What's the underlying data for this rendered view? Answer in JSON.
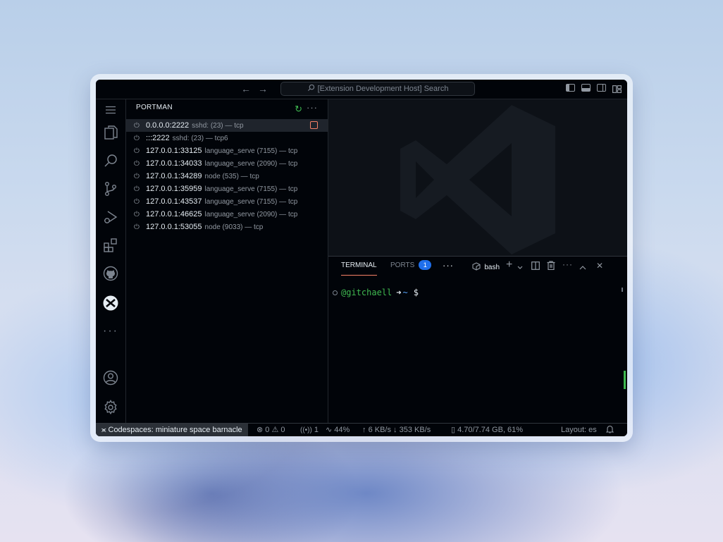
{
  "titlebar": {
    "back_icon": "←",
    "forward_icon": "→",
    "search_label": "[Extension Development Host] Search",
    "search_icon": "⌕"
  },
  "activitybar": {
    "items": [
      "menu",
      "explorer",
      "search",
      "source-control",
      "run-debug",
      "extensions",
      "github",
      "portman",
      "more",
      "accounts",
      "settings"
    ],
    "more_label": "···"
  },
  "sidebar": {
    "title": "PORTMAN",
    "more_label": "···",
    "refresh_icon": "↻",
    "ports": [
      {
        "address": "0.0.0.0:2222",
        "desc": "sshd: (23) — tcp"
      },
      {
        "address": ":::2222",
        "desc": "sshd: (23) — tcp6"
      },
      {
        "address": "127.0.0.1:33125",
        "desc": "language_serve (7155) — tcp"
      },
      {
        "address": "127.0.0.1:34033",
        "desc": "language_serve (2090) — tcp"
      },
      {
        "address": "127.0.0.1:34289",
        "desc": "node (535) — tcp"
      },
      {
        "address": "127.0.0.1:35959",
        "desc": "language_serve (7155) — tcp"
      },
      {
        "address": "127.0.0.1:43537",
        "desc": "language_serve (7155) — tcp"
      },
      {
        "address": "127.0.0.1:46625",
        "desc": "language_serve (2090) — tcp"
      },
      {
        "address": "127.0.0.1:53055",
        "desc": "node (9033) — tcp"
      }
    ]
  },
  "panel": {
    "tabs": {
      "terminal": "TERMINAL",
      "ports": "PORTS"
    },
    "ports_badge": "1",
    "more_label": "···",
    "shell_label": "bash",
    "add_icon": "+",
    "close_icon": "✕",
    "terminal": {
      "user": "@gitchaell",
      "arrow": "➜",
      "dir": "~",
      "prompt": "$"
    }
  },
  "statusbar": {
    "remote": "Codespaces: miniature space barnacle",
    "errors": "0",
    "warnings": "0",
    "ports": "1",
    "cpu": "44%",
    "upload": "6 KB/s",
    "download": "353 KB/s",
    "memory": "4.70/7.74 GB, 61%",
    "layout": "Layout: es"
  },
  "colors": {
    "accent": "#f78166",
    "green": "#3fb950",
    "blue": "#1f6feb",
    "background": "#010409"
  }
}
